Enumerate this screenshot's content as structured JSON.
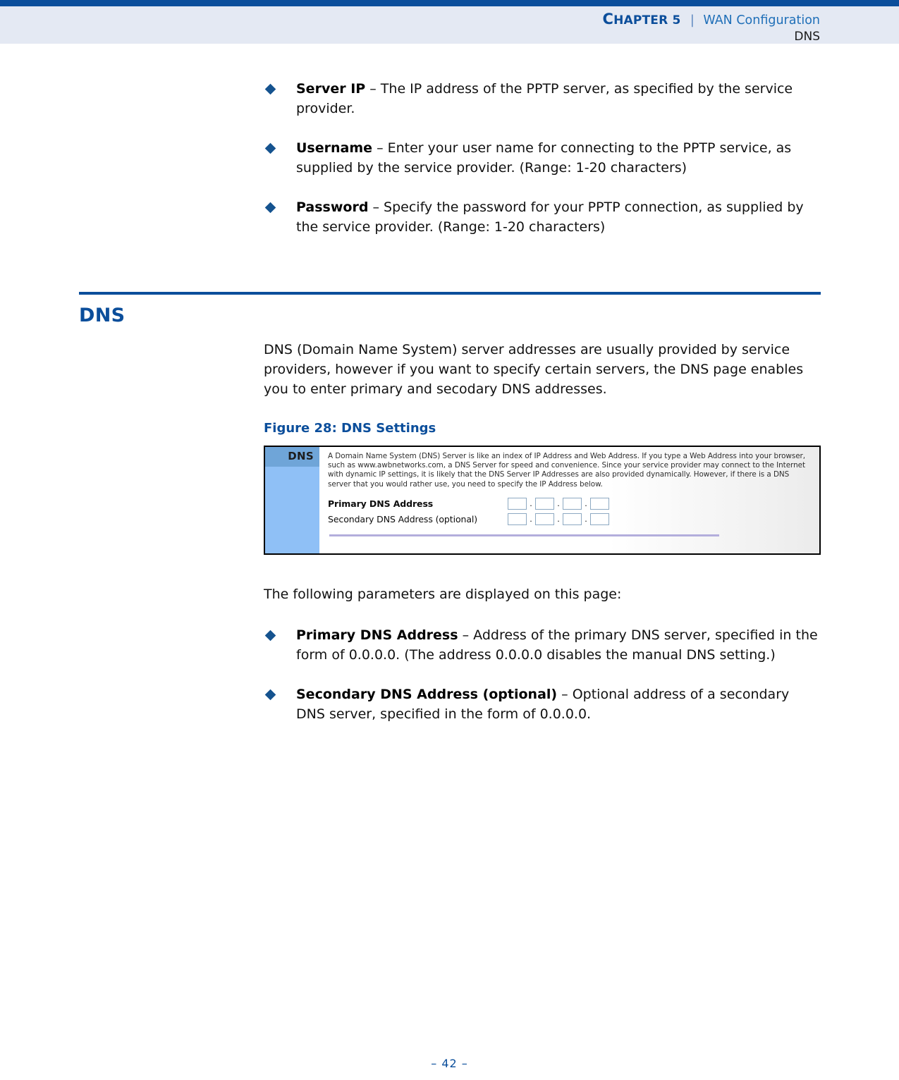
{
  "header": {
    "chapter_label": "Chapter 5",
    "chapter_number_prefix": "C",
    "chapter_rest": "HAPTER 5",
    "separator": "|",
    "chapter_title": "WAN Configuration",
    "section_name": "DNS"
  },
  "top_bullets": [
    {
      "term": "Server IP",
      "dash": " – ",
      "description": "The IP address of the PPTP server, as specified by the service provider."
    },
    {
      "term": "Username",
      "dash": " – ",
      "description": "Enter your user name for connecting to the PPTP service, as supplied by the service provider. (Range: 1-20 characters)"
    },
    {
      "term": "Password",
      "dash": " – ",
      "description": "Specify the password for your PPTP connection, as supplied by the service provider. (Range: 1-20 characters)"
    }
  ],
  "section": {
    "title": "DNS",
    "intro": "DNS (Domain Name System) server addresses are usually provided by service providers, however if you want to specify certain servers, the DNS page enables you to enter primary and secodary DNS addresses.",
    "figure_caption": "Figure 28:  DNS Settings"
  },
  "figure": {
    "sidebar_label": "DNS",
    "description": "A Domain Name System (DNS) Server is like an index of IP Address and Web Address. If you type a Web Address into your browser, such as www.awbnetworks.com, a DNS Server for speed and convenience. Since your service provider may connect to the Internet with dynamic IP settings, it is likely that the DNS Server IP Addresses are also provided dynamically. However, if there is a DNS server that you would rather use, you need to specify the IP Address below.",
    "fields": [
      {
        "label": "Primary DNS Address",
        "bold": true,
        "octets": [
          "",
          "",
          "",
          ""
        ],
        "separator": "."
      },
      {
        "label": "Secondary DNS Address (optional)",
        "bold": false,
        "octets": [
          "",
          "",
          "",
          ""
        ],
        "separator": "."
      }
    ]
  },
  "after_figure": {
    "lead": "The following parameters are displayed on this page:",
    "bullets": [
      {
        "term": "Primary DNS Address",
        "dash": " – ",
        "description": "Address of the primary DNS server, specified in the form of 0.0.0.0. (The address 0.0.0.0 disables the manual DNS setting.)"
      },
      {
        "term": "Secondary DNS Address (optional)",
        "dash": " – ",
        "description": "Optional address of a secondary DNS server, specified in the form of 0.0.0.0."
      }
    ]
  },
  "footer": {
    "page_marker": "–  42  –"
  },
  "colors": {
    "brand_blue": "#0b4e9b",
    "header_band": "#e4e9f3",
    "link_blue": "#1f6fb8",
    "bullet_diamond": "#15538f",
    "fig_sidebar": "#8fc0f6",
    "fig_sidebar_head": "#6fa5d8",
    "fig_divider": "#b3aedc",
    "input_border": "#8da9c2"
  }
}
